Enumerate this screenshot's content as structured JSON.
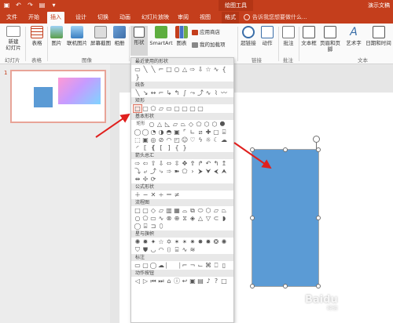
{
  "titlebar": {
    "qat": [
      "▣",
      "↶",
      "↷",
      "▤",
      "▾"
    ],
    "drawing_tools": "绘图工具",
    "doc_title": "演示文稿"
  },
  "tabs": [
    {
      "label": "文件"
    },
    {
      "label": "开始"
    },
    {
      "label": "插入"
    },
    {
      "label": "设计"
    },
    {
      "label": "切换"
    },
    {
      "label": "动画"
    },
    {
      "label": "幻灯片放映"
    },
    {
      "label": "审阅"
    },
    {
      "label": "视图"
    },
    {
      "label": "格式"
    }
  ],
  "tellme": "告诉我您想要做什么...",
  "ribbon": {
    "new_slide": "新建\n幻灯片",
    "table": "表格",
    "picture": "图片",
    "online_picture": "联机图片",
    "screenshot": "屏幕截图",
    "album": "相册",
    "shapes": "形状",
    "smartart": "SmartArt",
    "chart": "图表",
    "store": "应用商店",
    "my_addins": "我的加载项",
    "hyperlink": "超链接",
    "action": "动作",
    "comment": "批注",
    "textbox": "文本框",
    "header_footer": "页眉和页脚",
    "wordart": "艺术字",
    "datetime": "日期和时间",
    "groups": {
      "slides": "幻灯片",
      "tables": "表格",
      "images": "图像",
      "links": "链接",
      "comments": "批注",
      "text": "文本"
    }
  },
  "thumbnail": {
    "slide_number": "1"
  },
  "shapes_menu": {
    "recent": "最近使用的形状",
    "lines": "线条",
    "rectangles": "矩形",
    "basic": "基本形状",
    "basic_tag": "矩形",
    "block_arrows": "箭头总汇",
    "equation": "公式形状",
    "flowchart": "流程图",
    "stars": "星与旗帜",
    "callouts": "标注",
    "action_buttons": "动作按钮"
  },
  "watermark": {
    "text": "Baidu",
    "sub": "经验"
  },
  "colors": {
    "accent": "#c43e1c",
    "shape_fill": "#5b9bd5",
    "arrow": "#e0201e"
  }
}
